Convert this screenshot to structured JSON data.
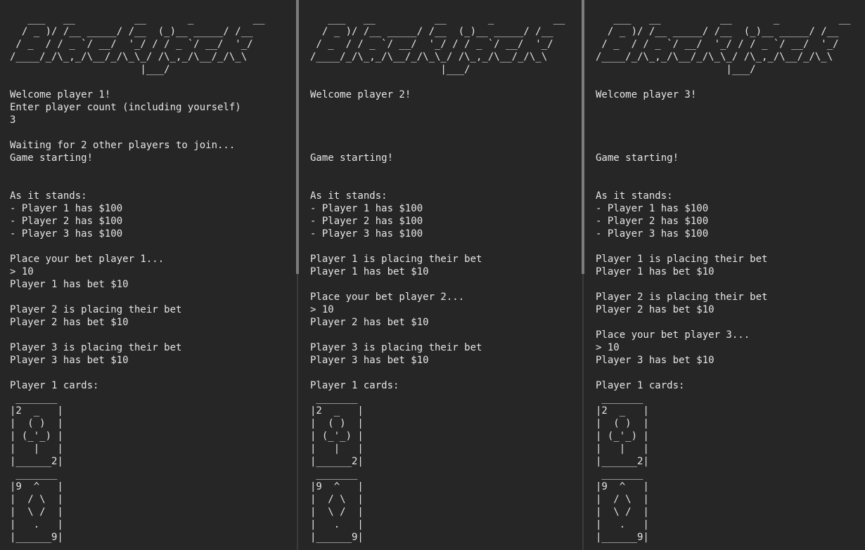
{
  "panes": [
    {
      "lines": [
        {
          "text": "   ___   __          __       _          __   "
        },
        {
          "text": "  / _ )/ /__ _____/ /__  (_)__ _____/ /__ "
        },
        {
          "text": " / _  / / _ `/ __/  '_/ / / _ `/ __/  '_/ "
        },
        {
          "text": "/____/_/\\_,_/\\__/_/\\_\\_/ /\\_,_/\\__/_/\\_\\  "
        },
        {
          "text": "                      |___/                  "
        },
        {
          "text": ""
        },
        {
          "text": "Welcome player 1!"
        },
        {
          "text": "Enter player count (including yourself)"
        },
        {
          "text": "3"
        },
        {
          "text": ""
        },
        {
          "text": "Waiting for 2 other players to join..."
        },
        {
          "text": "Game starting!"
        },
        {
          "text": ""
        },
        {
          "text": ""
        },
        {
          "text": "As it stands:"
        },
        {
          "text": "- Player 1 has $100"
        },
        {
          "text": "- Player 2 has $100"
        },
        {
          "text": "- Player 3 has $100"
        },
        {
          "text": ""
        },
        {
          "text": "Place your bet player 1..."
        },
        {
          "text": "> 10"
        },
        {
          "text": "Player 1 has bet $10"
        },
        {
          "text": ""
        },
        {
          "text": "Player 2 is placing their bet"
        },
        {
          "text": "Player 2 has bet $10"
        },
        {
          "text": ""
        },
        {
          "text": "Player 3 is placing their bet"
        },
        {
          "text": "Player 3 has bet $10"
        },
        {
          "text": ""
        },
        {
          "text": "Player 1 cards:"
        },
        {
          "text": " _______"
        },
        {
          "text": "|2  _   |"
        },
        {
          "text": "|  ( )  |"
        },
        {
          "text": "| (_'_) |"
        },
        {
          "text": "|   |   |"
        },
        {
          "text": "|______2|"
        },
        {
          "text": " _______"
        },
        {
          "text": "|9  ^   |"
        },
        {
          "text": "|  / \\  |"
        },
        {
          "text": "|  \\ /  |"
        },
        {
          "text": "|   .   |"
        },
        {
          "text": "|______9|"
        }
      ]
    },
    {
      "lines": [
        {
          "text": "   ___   __          __       _          __   "
        },
        {
          "text": "  / _ )/ /__ _____/ /__  (_)__ _____/ /__ "
        },
        {
          "text": " / _  / / _ `/ __/  '_/ / / _ `/ __/  '_/ "
        },
        {
          "text": "/____/_/\\_,_/\\__/_/\\_\\_/ /\\_,_/\\__/_/\\_\\  "
        },
        {
          "text": "                      |___/                  "
        },
        {
          "text": ""
        },
        {
          "text": "Welcome player 2!"
        },
        {
          "text": ""
        },
        {
          "text": ""
        },
        {
          "text": ""
        },
        {
          "text": ""
        },
        {
          "text": "Game starting!"
        },
        {
          "text": ""
        },
        {
          "text": ""
        },
        {
          "text": "As it stands:"
        },
        {
          "text": "- Player 1 has $100"
        },
        {
          "text": "- Player 2 has $100"
        },
        {
          "text": "- Player 3 has $100"
        },
        {
          "text": ""
        },
        {
          "text": "Player 1 is placing their bet"
        },
        {
          "text": "Player 1 has bet $10"
        },
        {
          "text": ""
        },
        {
          "text": "Place your bet player 2..."
        },
        {
          "text": "> 10"
        },
        {
          "text": "Player 2 has bet $10"
        },
        {
          "text": ""
        },
        {
          "text": "Player 3 is placing their bet"
        },
        {
          "text": "Player 3 has bet $10"
        },
        {
          "text": ""
        },
        {
          "text": "Player 1 cards:"
        },
        {
          "text": " _______"
        },
        {
          "text": "|2  _   |"
        },
        {
          "text": "|  ( )  |"
        },
        {
          "text": "| (_'_) |"
        },
        {
          "text": "|   |   |"
        },
        {
          "text": "|______2|"
        },
        {
          "text": " _______"
        },
        {
          "text": "|9  ^   |"
        },
        {
          "text": "|  / \\  |"
        },
        {
          "text": "|  \\ /  |"
        },
        {
          "text": "|   .   |"
        },
        {
          "text": "|______9|"
        }
      ]
    },
    {
      "lines": [
        {
          "text": "   ___   __          __       _          __   "
        },
        {
          "text": "  / _ )/ /__ _____/ /__  (_)__ _____/ /__ "
        },
        {
          "text": " / _  / / _ `/ __/  '_/ / / _ `/ __/  '_/ "
        },
        {
          "text": "/____/_/\\_,_/\\__/_/\\_\\_/ /\\_,_/\\__/_/\\_\\  "
        },
        {
          "text": "                      |___/                  "
        },
        {
          "text": ""
        },
        {
          "text": "Welcome player 3!"
        },
        {
          "text": ""
        },
        {
          "text": ""
        },
        {
          "text": ""
        },
        {
          "text": ""
        },
        {
          "text": "Game starting!"
        },
        {
          "text": ""
        },
        {
          "text": ""
        },
        {
          "text": "As it stands:"
        },
        {
          "text": "- Player 1 has $100"
        },
        {
          "text": "- Player 2 has $100"
        },
        {
          "text": "- Player 3 has $100"
        },
        {
          "text": ""
        },
        {
          "text": "Player 1 is placing their bet"
        },
        {
          "text": "Player 1 has bet $10"
        },
        {
          "text": ""
        },
        {
          "text": "Player 2 is placing their bet"
        },
        {
          "text": "Player 2 has bet $10"
        },
        {
          "text": ""
        },
        {
          "text": "Place your bet player 3..."
        },
        {
          "text": "> 10"
        },
        {
          "text": "Player 3 has bet $10"
        },
        {
          "text": ""
        },
        {
          "text": "Player 1 cards:"
        },
        {
          "text": " _______"
        },
        {
          "text": "|2  _   |"
        },
        {
          "text": "|  ( )  |"
        },
        {
          "text": "| (_'_) |"
        },
        {
          "text": "|   |   |"
        },
        {
          "text": "|______2|"
        },
        {
          "text": " _______"
        },
        {
          "text": "|9  ^   |"
        },
        {
          "text": "|  / \\  |"
        },
        {
          "text": "|  \\ /  |"
        },
        {
          "text": "|   .   |"
        },
        {
          "text": "|______9|"
        }
      ]
    }
  ],
  "colors": {
    "background": "#262626",
    "text": "#e6e6e6",
    "divider": "#3c3c3c",
    "scroll_thumb": "#7c7c7c"
  }
}
